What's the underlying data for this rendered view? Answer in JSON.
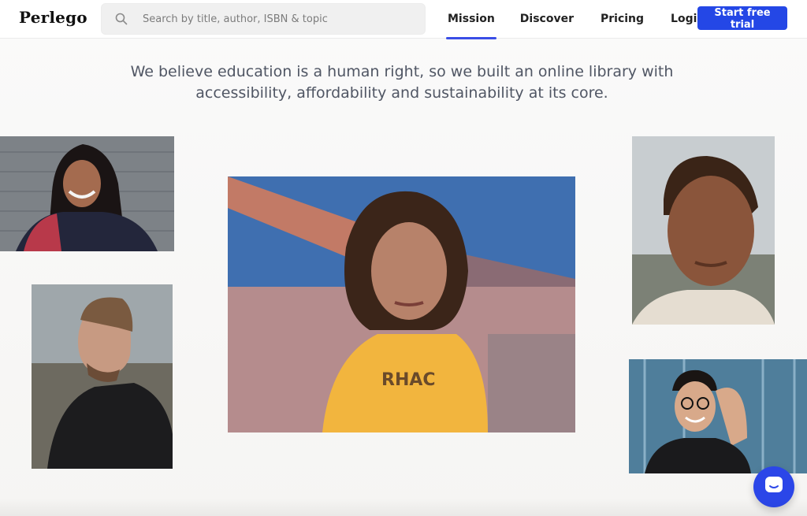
{
  "header": {
    "logo": "Perlego",
    "search": {
      "placeholder": "Search by title, author, ISBN & topic",
      "value": ""
    },
    "nav": [
      {
        "label": "Mission",
        "active": true
      },
      {
        "label": "Discover",
        "active": false
      },
      {
        "label": "Pricing",
        "active": false
      },
      {
        "label": "Login",
        "active": false
      }
    ],
    "cta_label": "Start free trial",
    "accent_color": "#2447e6"
  },
  "hero": {
    "line1": "We believe education is a human right, so we built an online library with",
    "line2": "accessibility, affordability and sustainability at its core."
  },
  "photos": [
    {
      "name": "smiling-woman-sari-photo"
    },
    {
      "name": "bearded-man-profile-photo"
    },
    {
      "name": "young-woman-yellow-shirt-photo"
    },
    {
      "name": "young-man-portrait-photo"
    },
    {
      "name": "man-glasses-smiling-photo"
    }
  ],
  "chat": {
    "icon": "chat-icon"
  }
}
